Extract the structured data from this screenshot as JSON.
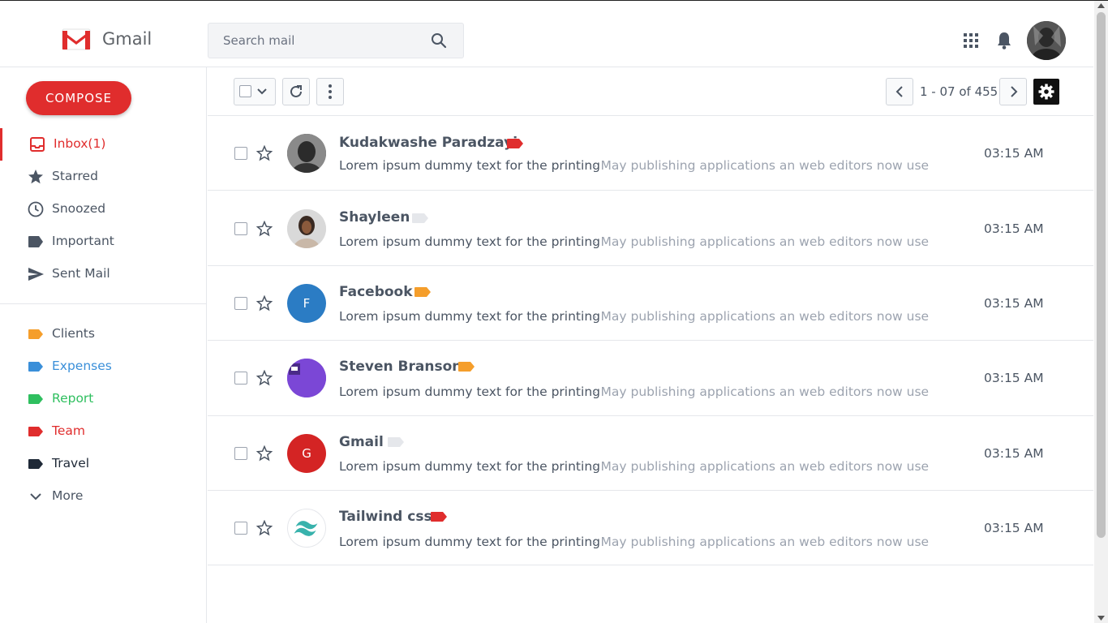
{
  "app": {
    "name": "Gmail"
  },
  "search": {
    "placeholder": "Search mail"
  },
  "sidebar": {
    "compose_label": "COMPOSE",
    "main_items": [
      {
        "label": "Inbox(1)",
        "icon": "inbox-icon",
        "active": true
      },
      {
        "label": "Starred",
        "icon": "star-icon"
      },
      {
        "label": "Snoozed",
        "icon": "clock-icon"
      },
      {
        "label": "Important",
        "icon": "label-icon"
      },
      {
        "label": "Sent Mail",
        "icon": "send-icon"
      }
    ],
    "labels": [
      {
        "label": "Clients",
        "color": "#f59e2b"
      },
      {
        "label": "Expenses",
        "color": "#3a8fd9"
      },
      {
        "label": "Report",
        "color": "#2fbf5f"
      },
      {
        "label": "Team",
        "color": "#e02d2d"
      },
      {
        "label": "Travel",
        "color": "#1f2937"
      }
    ],
    "more_label": "More"
  },
  "toolbar": {
    "pagination": "1 - 07 of 455"
  },
  "emails": [
    {
      "sender": "Kudakwashe Paradzayi",
      "tag_color": "#e02d2d",
      "subject": "Lorem ipsum dummy text for the printing",
      "snippet": "- May publishing applications an web editors now use",
      "time": "03:15 AM",
      "avatar": "photo"
    },
    {
      "sender": "Shayleen",
      "tag_color": "#e5e7eb",
      "subject": "Lorem ipsum dummy text for the printing",
      "snippet": "- May publishing applications an web editors now use",
      "time": "03:15 AM",
      "avatar": "photo"
    },
    {
      "sender": "Facebook",
      "tag_color": "#f59e2b",
      "subject": "Lorem ipsum dummy text for the printing",
      "snippet": "- May publishing applications an web editors now use",
      "time": "03:15 AM",
      "avatar_letter": "F",
      "avatar_color": "#2b7cc4"
    },
    {
      "sender": "Steven Branson",
      "tag_color": "#f59e2b",
      "subject": "Lorem ipsum dummy text for the printing",
      "snippet": "- May publishing applications an web editors now use",
      "time": "03:15 AM",
      "avatar_color": "#7b47d6"
    },
    {
      "sender": "Gmail",
      "tag_color": "#e5e7eb",
      "subject": "Lorem ipsum dummy text for the printing",
      "snippet": "- May publishing applications an web editors now use",
      "time": "03:15 AM",
      "avatar_letter": "G",
      "avatar_color": "#d42424"
    },
    {
      "sender": "Tailwind css",
      "tag_color": "#e02d2d",
      "subject": "Lorem ipsum dummy text for the printing",
      "snippet": "- May publishing applications an web editors now use",
      "time": "03:15 AM",
      "avatar": "tailwind-logo"
    }
  ]
}
